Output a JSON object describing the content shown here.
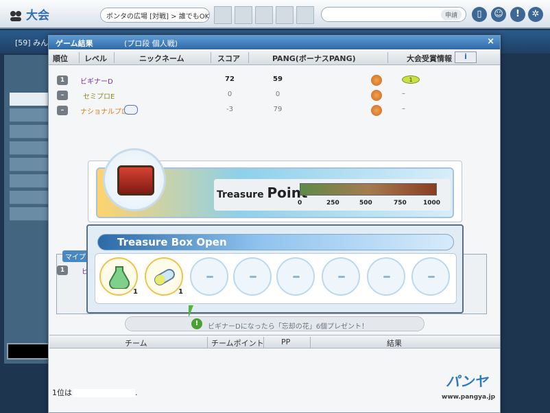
{
  "topbar": {
    "logo_text": "大会",
    "room_text": "ボンタの広場 [対戦] > 誰でもOK !!",
    "search_placeholder": "",
    "apply_label": "申請"
  },
  "background": {
    "room_strip": "[59] みん"
  },
  "dialog": {
    "title": "ゲーム結果",
    "subtitle": "(プロ段 個人戦)",
    "close": "×",
    "columns": {
      "rank": "順位",
      "level": "レベル",
      "nickname": "ニックネーム",
      "score": "スコア",
      "pang": "PANG(ボーナスPANG)",
      "tournament": "大会受賞情報",
      "info": "i"
    },
    "rows": [
      {
        "rank": "1",
        "nickname": "ビギナーD",
        "score": "72",
        "pang": "59",
        "reward_count": "1",
        "dash": ""
      },
      {
        "rank": "–",
        "nickname": "セミプロE",
        "score": "0",
        "pang": "0",
        "reward_count": "",
        "dash": "–"
      },
      {
        "rank": "–",
        "nickname": "ナショナルプロE",
        "score": "-3",
        "pang": "79",
        "reward_count": "",
        "dash": "–"
      }
    ]
  },
  "treasure_point": {
    "label_small": "Treasure",
    "label_big": "Point",
    "ticks": [
      "0",
      "250",
      "500",
      "750",
      "1000"
    ],
    "fill_fraction": 1.0
  },
  "box_open": {
    "title": "Treasure Box Open",
    "slots": [
      {
        "type": "item",
        "icon": "potion-icon",
        "count": "1"
      },
      {
        "type": "item",
        "icon": "capsule-icon",
        "count": "1"
      },
      {
        "type": "empty"
      },
      {
        "type": "empty"
      },
      {
        "type": "empty"
      },
      {
        "type": "empty"
      },
      {
        "type": "empty"
      },
      {
        "type": "empty"
      }
    ]
  },
  "message": {
    "bang": "!",
    "text": "ビギナーDになったら「忘却の花」6個プレゼント！"
  },
  "mypage": {
    "tag": "マイプ",
    "rank": "1",
    "name": "ビギ"
  },
  "team_table": {
    "team": "チーム",
    "team_point": "チームポイント",
    "pp": "PP",
    "result": "結果"
  },
  "footer": {
    "first_place": "1位は",
    "first_place_suffix": "."
  },
  "brand": {
    "logo": "パンヤ",
    "url": "www.pangya.jp"
  },
  "colors": {
    "accent": "#2f6aa8",
    "gold": "#f1c24a",
    "green": "#48a22f"
  }
}
